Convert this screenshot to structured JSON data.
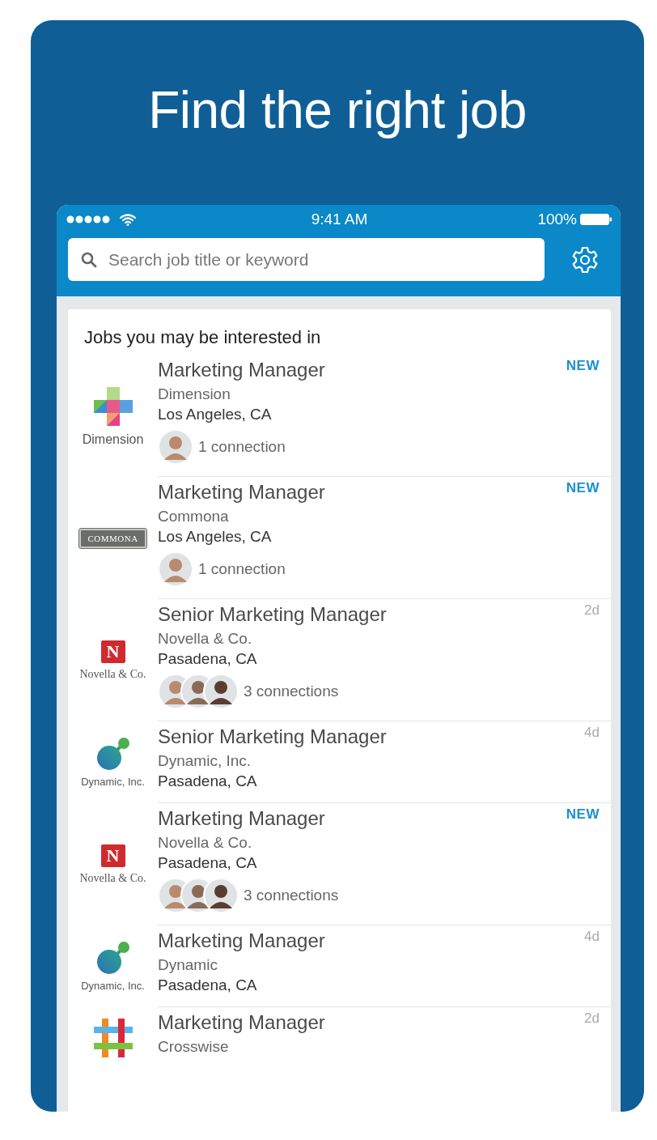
{
  "headline": "Find the right job",
  "status_bar": {
    "time": "9:41 AM",
    "battery": "100%"
  },
  "search": {
    "placeholder": "Search job title or keyword"
  },
  "section_title": "Jobs you may be interested in",
  "jobs": [
    {
      "logo": {
        "kind": "dimension",
        "text": "Dimension"
      },
      "title": "Marketing Manager",
      "company": "Dimension",
      "location": "Los Angeles, CA",
      "tag": "NEW",
      "highlight": true,
      "connections": {
        "label": "1 connection",
        "avatars": [
          {
            "kind": "person"
          }
        ]
      }
    },
    {
      "logo": {
        "kind": "commona",
        "text": "COMMONA"
      },
      "title": "Marketing Manager",
      "company": "Commona",
      "location": "Los Angeles, CA",
      "tag": "NEW",
      "highlight": true,
      "connections": {
        "label": "1 connection",
        "avatars": [
          {
            "kind": "person"
          }
        ]
      }
    },
    {
      "logo": {
        "kind": "novella",
        "mark": "N",
        "text": "Novella & Co."
      },
      "title": "Senior Marketing Manager",
      "company": "Novella & Co.",
      "location": "Pasadena, CA",
      "tag": "2d",
      "highlight": false,
      "connections": {
        "label": "3 connections",
        "avatars": [
          {
            "kind": "person"
          },
          {
            "kind": "person"
          },
          {
            "kind": "person"
          }
        ]
      }
    },
    {
      "logo": {
        "kind": "dynamic",
        "text": "Dynamic, Inc."
      },
      "title": "Senior Marketing Manager",
      "company": "Dynamic, Inc.",
      "location": "Pasadena, CA",
      "tag": "4d",
      "highlight": false
    },
    {
      "logo": {
        "kind": "novella",
        "mark": "N",
        "text": "Novella & Co."
      },
      "title": "Marketing Manager",
      "company": "Novella & Co.",
      "location": "Pasadena, CA",
      "tag": "NEW",
      "highlight": true,
      "connections": {
        "label": "3 connections",
        "avatars": [
          {
            "kind": "person"
          },
          {
            "kind": "person"
          },
          {
            "kind": "person"
          }
        ]
      }
    },
    {
      "logo": {
        "kind": "dynamic",
        "text": "Dynamic, Inc."
      },
      "title": "Marketing Manager",
      "company": "Dynamic",
      "location": "Pasadena, CA",
      "tag": "4d",
      "highlight": false
    },
    {
      "logo": {
        "kind": "crosswise"
      },
      "title": "Marketing Manager",
      "company": "Crosswise",
      "tag": "2d",
      "highlight": false
    }
  ]
}
